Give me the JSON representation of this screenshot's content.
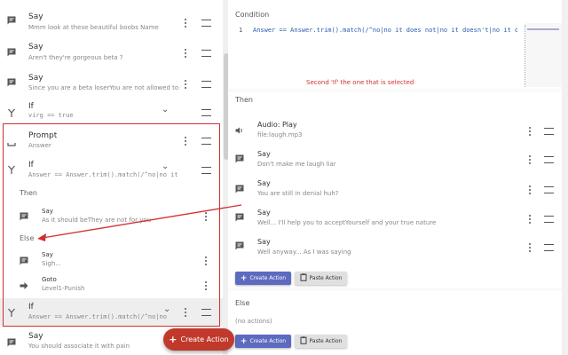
{
  "left_list": {
    "items": [
      {
        "title": "Say",
        "subtitle": "Mmm look at these beautiful boobs Name",
        "icon": "chat-icon"
      },
      {
        "title": "Say",
        "subtitle": "Aren't they're gorgeous beta ?",
        "icon": "chat-icon"
      },
      {
        "title": "Say",
        "subtitle": "Since you are a beta loserYou are not allowed to seeThis ...",
        "icon": "chat-icon"
      },
      {
        "title": "If",
        "subtitle": "virg == true",
        "icon": "fork-icon"
      },
      {
        "title": "Prompt",
        "subtitle": "Answer",
        "icon": "prompt-icon"
      },
      {
        "title": "If",
        "subtitle": "Answer == Answer.trim().match(/^no|no it does ...",
        "icon": "fork-icon"
      }
    ],
    "then_label": "Then",
    "then_items": [
      {
        "title": "Say",
        "subtitle": "As it should beThey are not for you after all"
      }
    ],
    "else_label": "Else",
    "else_items": [
      {
        "title": "Say",
        "subtitle": "Sigh..."
      },
      {
        "title": "Goto",
        "subtitle": "Level1-Punish"
      }
    ],
    "selected_if": {
      "title": "If",
      "subtitle": "Answer == Answer.trim().match(/^no|no it does ..."
    },
    "last_item": {
      "title": "Say",
      "subtitle": "You should associate it with pain"
    }
  },
  "create_fab": {
    "label": "Create Action"
  },
  "condition": {
    "title": "Condition",
    "line_number": "1",
    "code": "Answer == Answer.trim().match(/^no|no it does not|no it doesn't|no it doesnt",
    "annotation": "Second 'If' the one that is selected"
  },
  "then_section": {
    "title": "Then",
    "actions": [
      {
        "title": "Audio: Play",
        "subtitle": "file:laugh.mp3",
        "icon": "speaker-icon"
      },
      {
        "title": "Say",
        "subtitle": "Don't make me laugh liar",
        "icon": "chat-icon"
      },
      {
        "title": "Say",
        "subtitle": "You are still in denial huh?",
        "icon": "chat-icon"
      },
      {
        "title": "Say",
        "subtitle": "Well... I'll help you to acceptYourself and your true nature",
        "icon": "chat-icon"
      },
      {
        "title": "Say",
        "subtitle": "Well anyway... As I was saying",
        "icon": "chat-icon"
      }
    ],
    "create_label": "Create Action",
    "paste_label": "Paste Action"
  },
  "else_section": {
    "title": "Else",
    "empty_text": "(no actions)",
    "create_label": "Create Action",
    "paste_label": "Paste Action"
  },
  "colors": {
    "accent": "#5c6bc0",
    "fab": "#c0392b",
    "highlight": "#d32f2f"
  }
}
